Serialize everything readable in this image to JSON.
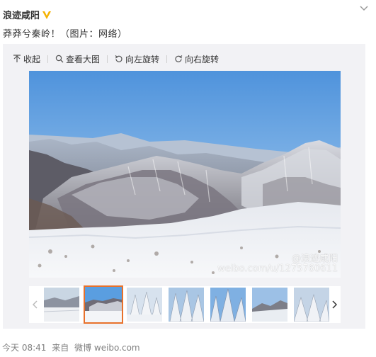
{
  "post": {
    "author": "浪迹咸阳",
    "text": "莽莽兮秦岭！（图片：网络）",
    "verified_icon": "verified-v-icon",
    "menu_icon": "chevron-down-icon"
  },
  "toolbar": {
    "collapse": "收起",
    "view_large": "查看大图",
    "rotate_left": "向左旋转",
    "rotate_right": "向右旋转"
  },
  "photo": {
    "watermark_line1": "@浪迹咸阳",
    "watermark_line2": "weibo.com/u/1275760611",
    "description_colors": {
      "sky": "#5a9ee0",
      "snow": "#f4f6f9",
      "mountain": "#6b6a74"
    }
  },
  "thumbnails": {
    "count": 8,
    "active_index": 1,
    "prev_icon": "chevron-left-icon",
    "next_icon": "chevron-right-icon"
  },
  "footer": {
    "time": "今天 08:41",
    "source_prefix": "来自",
    "source": "微博 weibo.com"
  },
  "colors": {
    "accent": "#e8712b",
    "author": "#333333",
    "footer": "#808080",
    "verified": "#f5b200"
  }
}
